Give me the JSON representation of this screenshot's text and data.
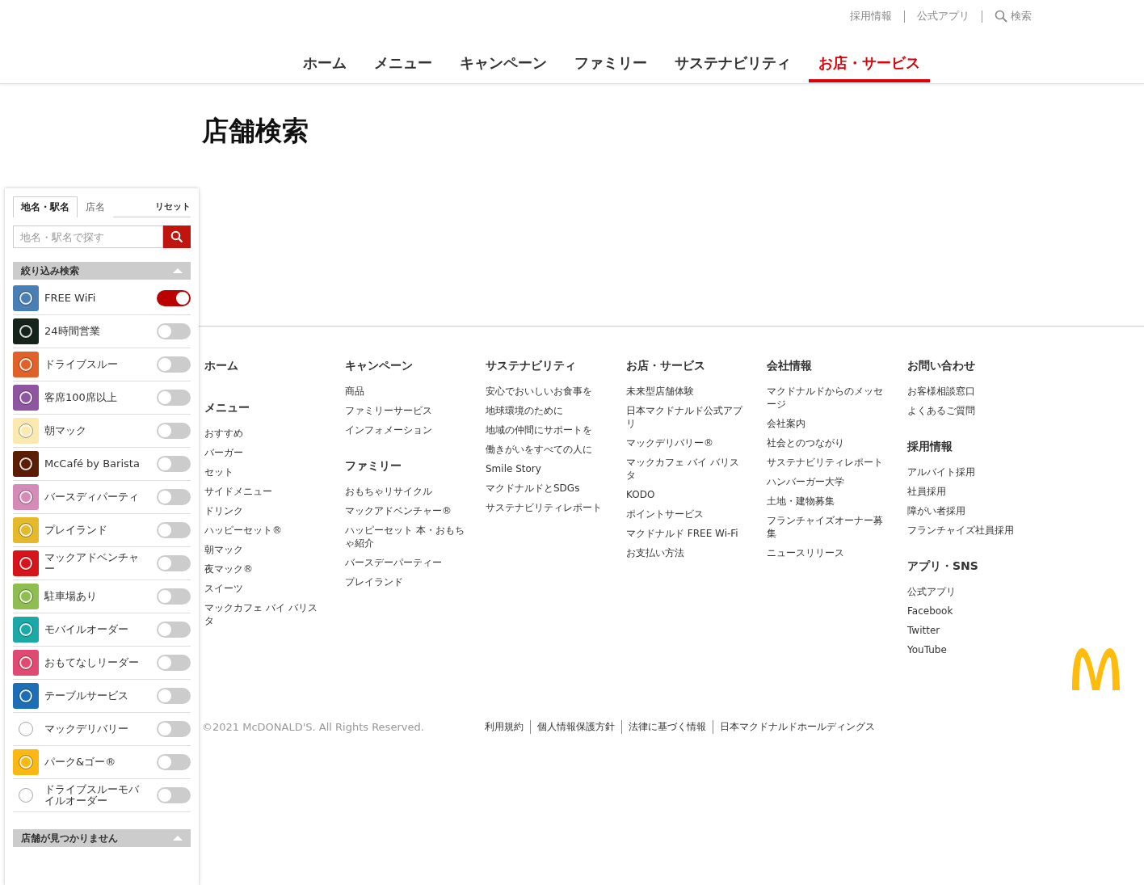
{
  "header": {
    "utility_links": [
      {
        "label": "採用情報",
        "kind": "text"
      },
      {
        "label": "公式アプリ",
        "kind": "text"
      },
      {
        "label": "検索",
        "kind": "search"
      }
    ],
    "nav": [
      {
        "label": "ホーム",
        "selected": false
      },
      {
        "label": "メニュー",
        "selected": false
      },
      {
        "label": "キャンペーン",
        "selected": false
      },
      {
        "label": "ファミリー",
        "selected": false
      },
      {
        "label": "サステナビリティ",
        "selected": false
      },
      {
        "label": "お店・サービス",
        "selected": true
      }
    ]
  },
  "page_title": "店舗検索",
  "store_panel": {
    "tabs": [
      {
        "label": "地名・駅名",
        "selected": true
      },
      {
        "label": "店名",
        "selected": false
      }
    ],
    "reset": "リセット",
    "search": {
      "placeholder": "地名・駅名で探す"
    },
    "filter_header": "絞り込み検索",
    "filters": [
      {
        "label": "FREE WiFi",
        "on": true,
        "color": "#4a7fb5"
      },
      {
        "label": "24時間営業",
        "on": false,
        "color": "#15241a"
      },
      {
        "label": "ドライブスルー",
        "on": false,
        "color": "#e06228"
      },
      {
        "label": "客席100席以上",
        "on": false,
        "color": "#8e56a0"
      },
      {
        "label": "朝マック",
        "on": false,
        "color": "#fbe9b0"
      },
      {
        "label": "McCafé by Barista",
        "on": false,
        "color": "#5c1d05"
      },
      {
        "label": "バースディパーティ",
        "on": false,
        "color": "#d58ab8"
      },
      {
        "label": "プレイランド",
        "on": false,
        "color": "#e6b92b"
      },
      {
        "label": "マックアドベンチャー",
        "on": false,
        "color": "#d8141b"
      },
      {
        "label": "駐車場あり",
        "on": false,
        "color": "#8ebe4f"
      },
      {
        "label": "モバイルオーダー",
        "on": false,
        "color": "#1aa9a6"
      },
      {
        "label": "おもてなしリーダー",
        "on": false,
        "color": "#e04a72"
      },
      {
        "label": "テーブルサービス",
        "on": false,
        "color": "#1d6fb5"
      },
      {
        "label": "マックデリバリー",
        "on": false,
        "color": "#ffffff"
      },
      {
        "label": "パーク&ゴー®",
        "on": false,
        "color": "#fbb813"
      },
      {
        "label": "ドライブスルーモバイルオーダー",
        "on": false,
        "color": "#ffffff"
      }
    ],
    "result_header": "店舗が見つかりません"
  },
  "footer": {
    "columns": [
      [
        {
          "heading": "ホーム"
        },
        {
          "heading": "メニュー",
          "links": [
            "おすすめ",
            "バーガー",
            "セット",
            "サイドメニュー",
            "ドリンク",
            "ハッピーセット®",
            "朝マック",
            "夜マック®",
            "スイーツ",
            "マックカフェ バイ バリスタ"
          ]
        }
      ],
      [
        {
          "heading": "キャンペーン",
          "links": [
            "商品",
            "ファミリーサービス",
            "インフォメーション"
          ]
        },
        {
          "heading": "ファミリー",
          "links": [
            "おもちゃリサイクル",
            "マックアドベンチャー®",
            "ハッピーセット 本・おもちゃ紹介",
            "バースデーパーティー",
            "プレイランド"
          ]
        }
      ],
      [
        {
          "heading": "サステナビリティ",
          "links": [
            "安心でおいしいお食事を",
            "地球環境のために",
            "地域の仲間にサポートを",
            "働きがいをすべての人に",
            "Smile Story",
            "マクドナルドとSDGs",
            "サステナビリティレポート"
          ]
        }
      ],
      [
        {
          "heading": "お店・サービス",
          "links": [
            "未来型店舗体験",
            "日本マクドナルド公式アプリ",
            "マックデリバリー®",
            "マックカフェ バイ バリスタ",
            "KODO",
            "ポイントサービス",
            "マクドナルド FREE Wi-Fi",
            "お支払い方法"
          ]
        }
      ],
      [
        {
          "heading": "会社情報",
          "links": [
            "マクドナルドからのメッセージ",
            "会社案内",
            "社会とのつながり",
            "サステナビリティレポート",
            "ハンバーガー大学",
            "土地・建物募集",
            "フランチャイズオーナー募集",
            "ニュースリリース"
          ]
        }
      ],
      [
        {
          "heading": "お問い合わせ",
          "links": [
            "お客様相談窓口",
            "よくあるご質問"
          ]
        },
        {
          "heading": "採用情報",
          "links": [
            "アルバイト採用",
            "社員採用",
            "障がい者採用",
            "フランチャイズ社員採用"
          ]
        },
        {
          "heading": "アプリ・SNS",
          "links": [
            "公式アプリ",
            "Facebook",
            "Twitter",
            "YouTube"
          ]
        }
      ]
    ],
    "copyright": "©2021 McDONALD'S. All Rights Reserved.",
    "legal_links": [
      "利用規約",
      "個人情報保護方針",
      "法律に基づく情報",
      "日本マクドナルドホールディングス"
    ]
  }
}
